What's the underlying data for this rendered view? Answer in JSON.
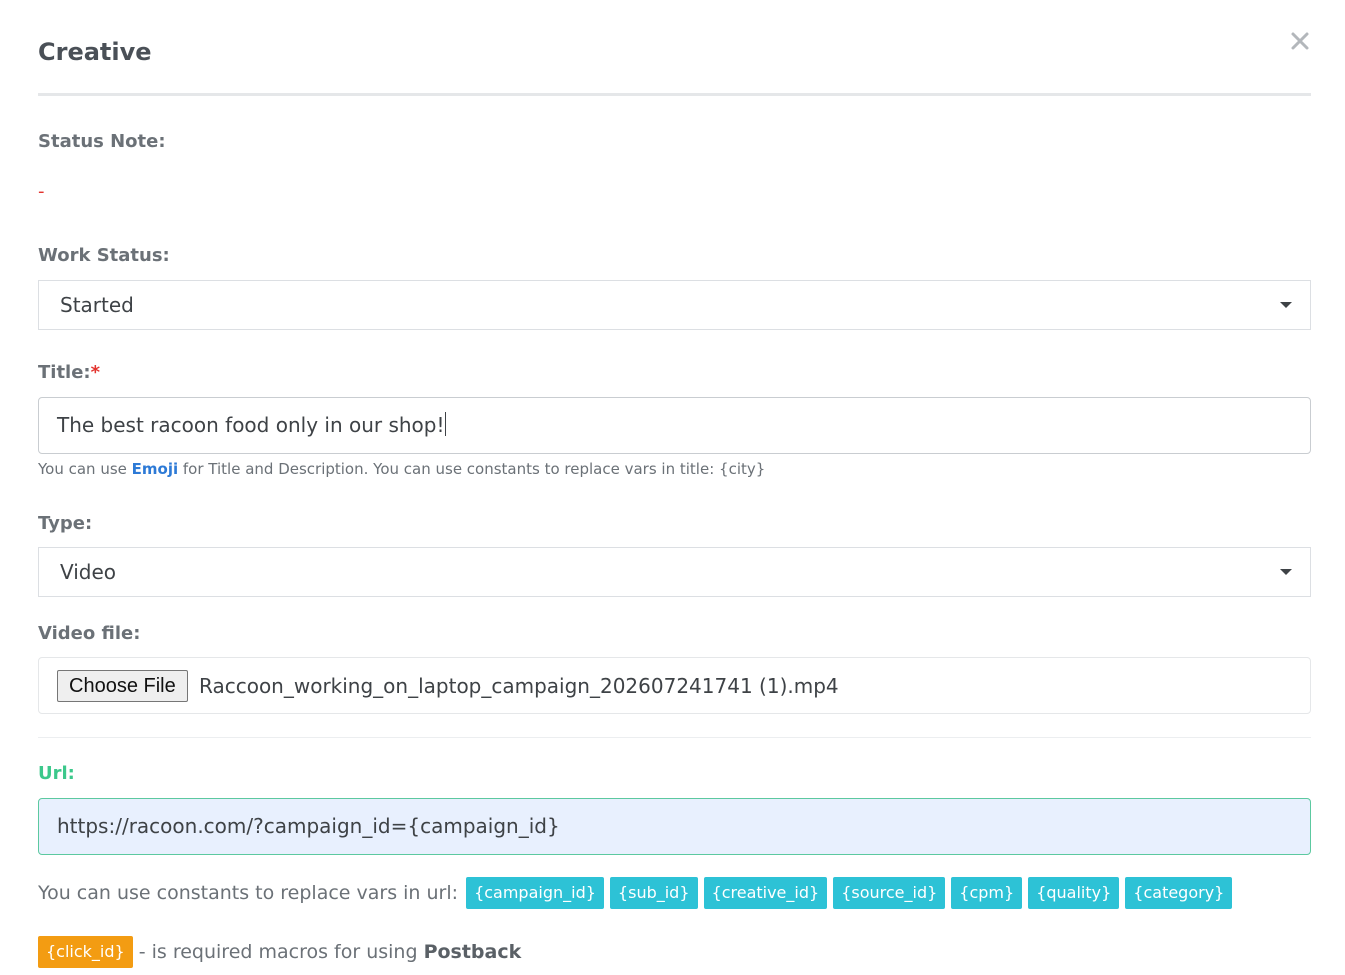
{
  "modal": {
    "title": "Creative",
    "close_label": "×"
  },
  "status_note": {
    "label": "Status Note:",
    "value": "-"
  },
  "work_status": {
    "label": "Work Status:",
    "selected": "Started"
  },
  "title_field": {
    "label": "Title:",
    "required_mark": "*",
    "value": "The best racoon food only in our shop!",
    "help_prefix": "You can use ",
    "help_link": "Emoji",
    "help_suffix": " for Title and Description. You can use constants to replace vars in title: {city}"
  },
  "type_field": {
    "label": "Type:",
    "selected": "Video"
  },
  "video_file": {
    "label": "Video file:",
    "button_label": "Choose File",
    "file_name": "Raccoon_working_on_laptop_campaign_202607241741 (1).mp4"
  },
  "url_field": {
    "label": "Url:",
    "value": "https://racoon.com/?campaign_id={campaign_id}",
    "constants_lead": "You can use constants to replace vars in url:",
    "constants": [
      "{campaign_id}",
      "{sub_id}",
      "{creative_id}",
      "{source_id}",
      "{cpm}",
      "{quality}",
      "{category}"
    ]
  },
  "postback": {
    "macro": "{click_id}",
    "desc_prefix": " - is required macros for using ",
    "desc_bold": "Postback"
  },
  "colors": {
    "tag": "#2dc2d6",
    "required_tag": "#f39c12",
    "url_label": "#3cc88b",
    "link": "#2d7ad6"
  }
}
